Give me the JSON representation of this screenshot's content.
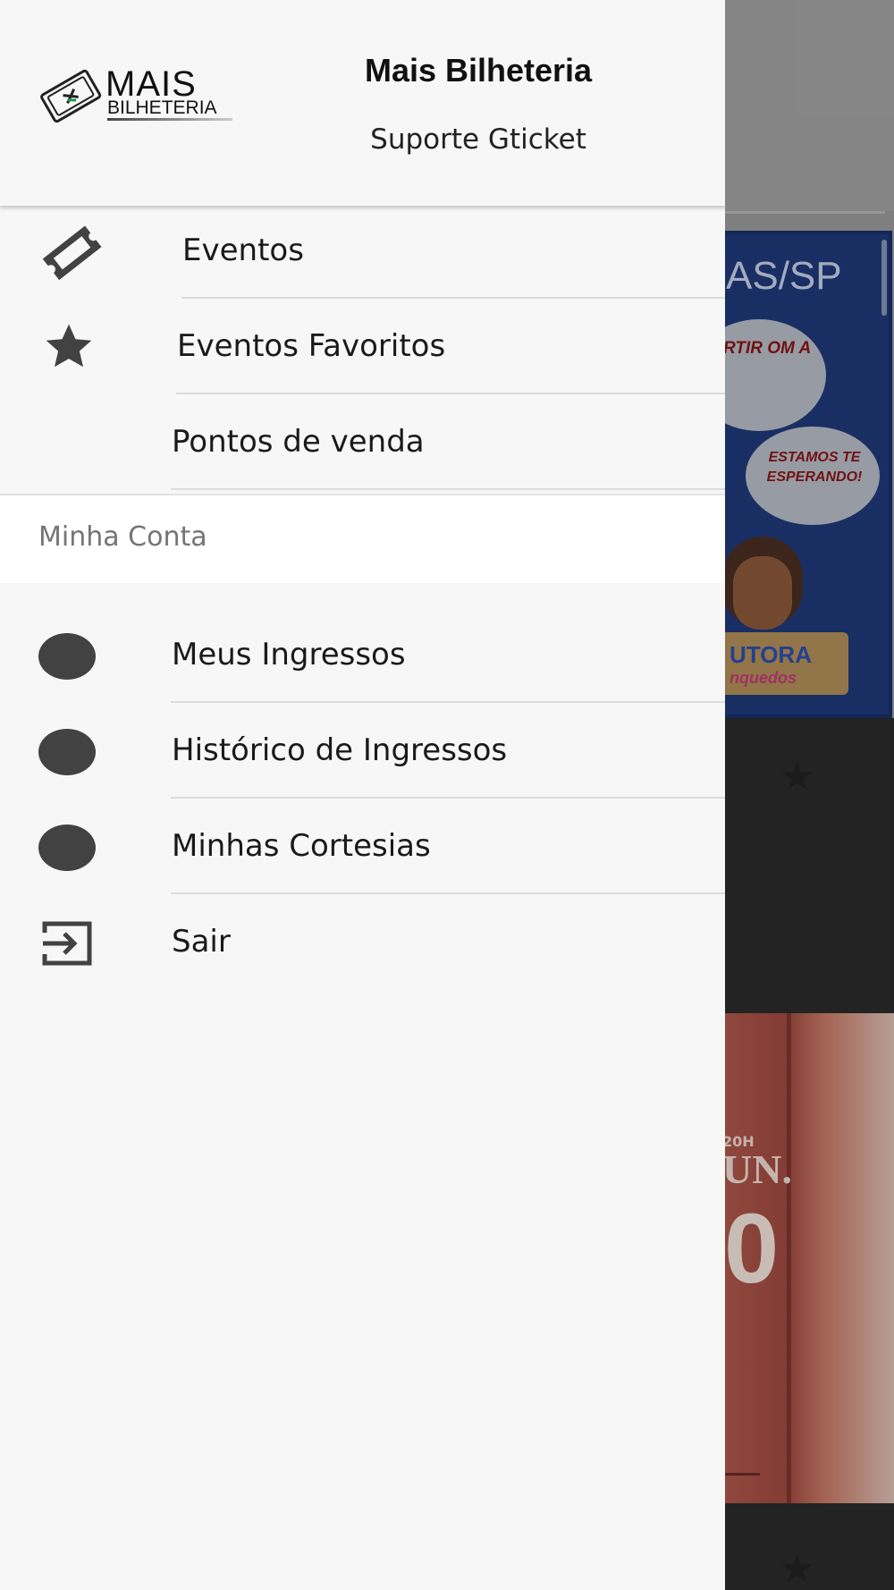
{
  "header": {
    "logo_line1": "MAIS",
    "logo_line2": "BILHETERIA",
    "title": "Mais Bilheteria",
    "subtitle": "Suporte Gticket"
  },
  "menu": {
    "items": [
      {
        "label": "Eventos",
        "icon": "ticket-icon"
      },
      {
        "label": "Eventos Favoritos",
        "icon": "star-icon"
      },
      {
        "label": "Pontos de venda",
        "icon": "none"
      }
    ]
  },
  "account": {
    "section_label": "Minha Conta",
    "items": [
      {
        "label": "Meus Ingressos",
        "icon": "circle-icon"
      },
      {
        "label": "Histórico de Ingressos",
        "icon": "circle-icon"
      },
      {
        "label": "Minhas Cortesias",
        "icon": "circle-icon"
      },
      {
        "label": "Sair",
        "icon": "logout-icon"
      }
    ]
  },
  "background": {
    "card1_place": "AS/SP",
    "card1_bubble1": "RTIR OM A",
    "card1_bubble2": "ESTAMOS TE ESPERANDO!",
    "card1_sign_top": "UTORA",
    "card1_sign_bottom": "nquedos",
    "card2_time": "20H",
    "card2_month": "UN.",
    "card2_number": "0"
  },
  "colors": {
    "drawer_bg": "#f7f7f7",
    "section_bg": "#ffffff",
    "icon": "#424242",
    "text": "#1a1a1a",
    "section_text": "#757575"
  }
}
